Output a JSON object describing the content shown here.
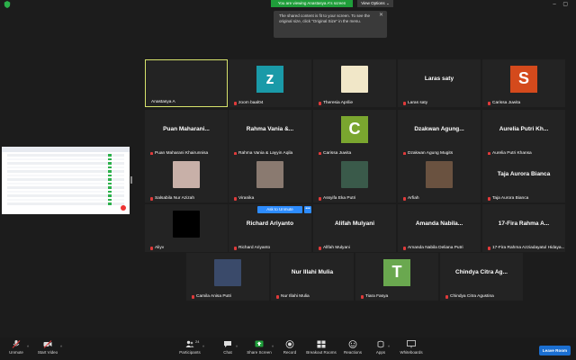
{
  "banner": {
    "viewing": "You are viewing Anastasya A's screen",
    "view_options": "View Options",
    "view_options_caret": "⌄",
    "tooltip_text": "The shared content is fit to your screen. To see the original size, click \"Original Size\" in the menu.",
    "tooltip_close": "✕",
    "window_controls": "– ▢"
  },
  "unmute_popup": {
    "ask_to_unmute": "Ask to Unmute",
    "more": "•••"
  },
  "tiles": [
    {
      "name": "Anastasya A",
      "center": "",
      "kind": "video"
    },
    {
      "name": "zoom baal04",
      "center": "z",
      "kind": "avatar",
      "color": "#1a9aa8"
    },
    {
      "name": "Theresia Aprilie",
      "center": "",
      "kind": "photo",
      "color": "#f1e7c8"
    },
    {
      "name": "Laras saty",
      "center": "Laras saty",
      "kind": "text"
    },
    {
      "name": "Carissa Juwita",
      "center": "S",
      "kind": "avatar",
      "color": "#d44a1c"
    },
    {
      "name": "Puan Maharani Khairunnisa",
      "center": "Puan Maharani...",
      "kind": "text"
    },
    {
      "name": "Rahma Vania & Layyin Aqila",
      "center": "Rahma Vania &...",
      "kind": "text"
    },
    {
      "name": "Carissa Juwita",
      "center": "C",
      "kind": "avatar",
      "color": "#7aa62f"
    },
    {
      "name": "Dzakwan Agung Mugits",
      "center": "Dzakwan Agung...",
      "kind": "text"
    },
    {
      "name": "Aurelia Putri Khansa",
      "center": "Aurelia Putri Kh...",
      "kind": "text"
    },
    {
      "name": "Salsabila Nur Azizah",
      "center": "",
      "kind": "photo",
      "color": "#c8b0a8"
    },
    {
      "name": "Viranika",
      "center": "",
      "kind": "photo",
      "color": "#8a7a70"
    },
    {
      "name": "Assyifa Eka Putri",
      "center": "",
      "kind": "photo",
      "color": "#3a5a4a"
    },
    {
      "name": "Arfiah",
      "center": "",
      "kind": "photo",
      "color": "#6a5240"
    },
    {
      "name": "Taja Aurora Bianca",
      "center": "Taja Aurora Bianca",
      "kind": "text"
    },
    {
      "name": "Aliyv",
      "center": "",
      "kind": "black"
    },
    {
      "name": "Richard Ariyanto",
      "center": "Richard Ariyanto",
      "kind": "text"
    },
    {
      "name": "Allfah Mulyani",
      "center": "Alifah Mulyani",
      "kind": "text"
    },
    {
      "name": "Amanda Nabila Deliana Putri",
      "center": "Amanda Nabila...",
      "kind": "text"
    },
    {
      "name": "17-Fira Rahma Azziadayatul Hidaya...",
      "center": "17-Fira Rahma A...",
      "kind": "text"
    },
    {
      "name": "Camila Anisa Putri",
      "center": "",
      "kind": "photo",
      "color": "#3a4a6a"
    },
    {
      "name": "Nur Illahi Mulia",
      "center": "Nur Illahi Mulia",
      "kind": "text"
    },
    {
      "name": "Tiara Fasya",
      "center": "T",
      "kind": "avatar",
      "color": "#6aa84f"
    },
    {
      "name": "Chindya Citra Agustina",
      "center": "Chindya Citra Ag...",
      "kind": "text"
    }
  ],
  "toolbar": {
    "unmute": "Unmute",
    "start_video": "Start Video",
    "participants": "Participants",
    "participants_count": "24",
    "chat": "Chat",
    "share_screen": "Share Screen",
    "record": "Record",
    "breakout": "Breakout Rooms",
    "reactions": "Reactions",
    "apps": "Apps",
    "whiteboards": "Whiteboards",
    "leave": "Leave Room",
    "caret": "^"
  },
  "colors": {
    "share_green": "#1f9e3a",
    "accent_blue": "#2d8cff",
    "active_border": "#d7e36c",
    "mute_red": "#e03a3a"
  }
}
